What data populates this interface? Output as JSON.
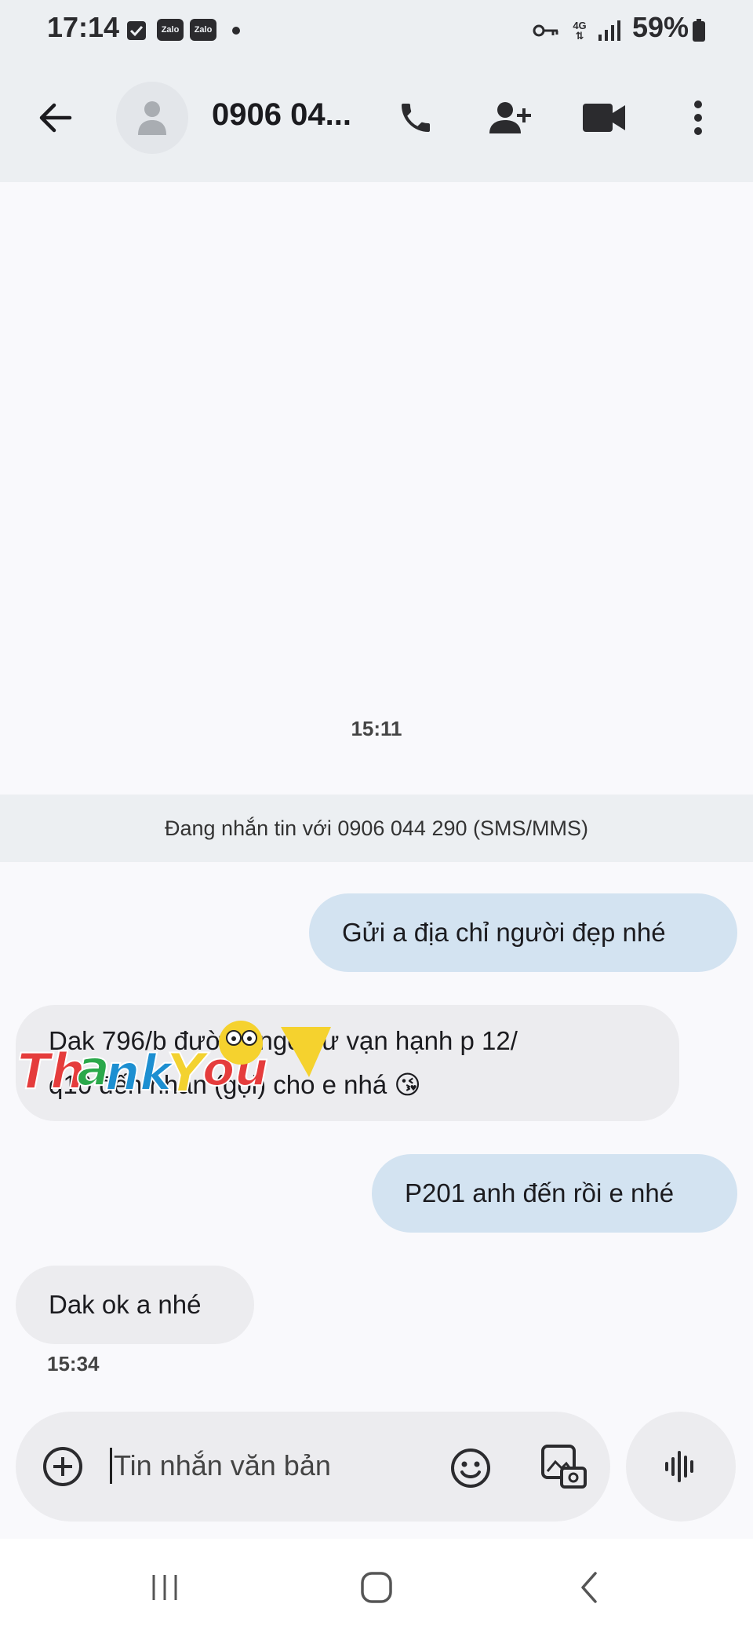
{
  "status_bar": {
    "time": "17:14",
    "zalo_label": "Zalo",
    "network": "4G",
    "battery": "59%"
  },
  "header": {
    "contact": "0906 04..."
  },
  "conversation": {
    "time_divider": "15:11",
    "sms_banner": "Đang nhắn tin với 0906 044 290 (SMS/MMS)",
    "messages": [
      {
        "direction": "out",
        "text": "Gửi a địa chỉ người đẹp nhé"
      },
      {
        "direction": "in",
        "line1": "Dak 796/b đường ngô sư vạn hạnh p 12/",
        "line2": "q10 đến nhắn (gọi) cho e nhá 😘",
        "sticker": "Thank You"
      },
      {
        "direction": "out",
        "text": "P201 anh đến rồi e nhé"
      },
      {
        "direction": "in",
        "text": "Dak ok a nhé"
      }
    ],
    "last_time": "15:34"
  },
  "compose": {
    "placeholder": "Tin nhắn văn bản"
  },
  "colors": {
    "outgoing_bubble": "#d3e3f1",
    "incoming_bubble": "#ececef",
    "header_bg": "#eceff2"
  }
}
